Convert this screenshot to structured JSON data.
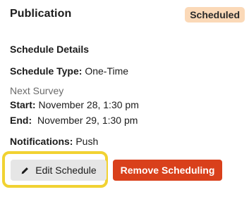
{
  "publication": {
    "title": "Publication",
    "status_badge": "Scheduled"
  },
  "schedule": {
    "section_title": "Schedule Details",
    "type_label": "Schedule Type:",
    "type_value": "One-Time",
    "next_label": "Next Survey",
    "start_label": "Start:",
    "start_value": "November 28, 1:30 pm",
    "end_label": "End:",
    "end_value": "November 29, 1:30 pm",
    "notifications_label": "Notifications:",
    "notifications_value": "Push"
  },
  "actions": {
    "edit_label": "Edit Schedule",
    "edit_icon": "pencil-icon",
    "remove_label": "Remove Scheduling"
  },
  "colors": {
    "badge_bg": "#fbd9b8",
    "highlight": "#f1d232",
    "remove_bg": "#d9401b",
    "edit_bg": "#e6e6e6"
  }
}
